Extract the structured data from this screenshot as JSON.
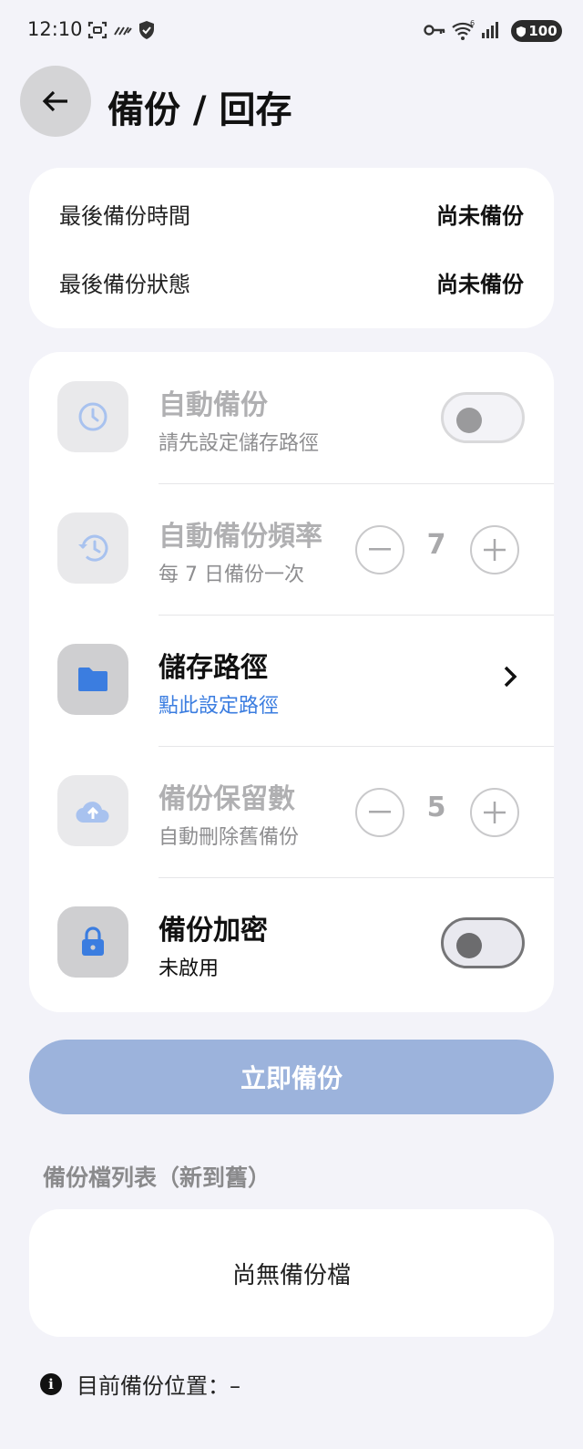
{
  "status_bar": {
    "time": "12:10",
    "battery": "100",
    "icons": [
      "screenshot-icon",
      "stripes-icon",
      "shield-icon",
      "key-icon",
      "wifi-icon",
      "signal-icon",
      "battery-icon"
    ]
  },
  "header": {
    "title": "備份 / 回存",
    "back_icon": "arrow-left-icon"
  },
  "info": {
    "last_backup_time_label": "最後備份時間",
    "last_backup_time_value": "尚未備份",
    "last_backup_status_label": "最後備份狀態",
    "last_backup_status_value": "尚未備份"
  },
  "settings": {
    "auto_backup": {
      "title": "自動備份",
      "subtitle": "請先設定儲存路徑",
      "icon": "clock-icon",
      "enabled": false
    },
    "frequency": {
      "title": "自動備份頻率",
      "subtitle": "每 7 日備份一次",
      "value": "7",
      "icon": "history-icon"
    },
    "storage_path": {
      "title": "儲存路徑",
      "subtitle": "點此設定路徑",
      "icon": "folder-icon"
    },
    "retention": {
      "title": "備份保留數",
      "subtitle": "自動刪除舊備份",
      "value": "5",
      "icon": "cloud-upload-icon"
    },
    "encryption": {
      "title": "備份加密",
      "subtitle": "未啟用",
      "icon": "lock-icon",
      "enabled": false
    }
  },
  "backup_now_label": "立即備份",
  "file_list": {
    "heading": "備份檔列表（新到舊）",
    "empty_text": "尚無備份檔"
  },
  "footer": {
    "location_text": "目前備份位置：–"
  },
  "colors": {
    "accent": "#3b7de0",
    "button_disabled": "#9cb3dc",
    "background": "#f3f3f9"
  }
}
